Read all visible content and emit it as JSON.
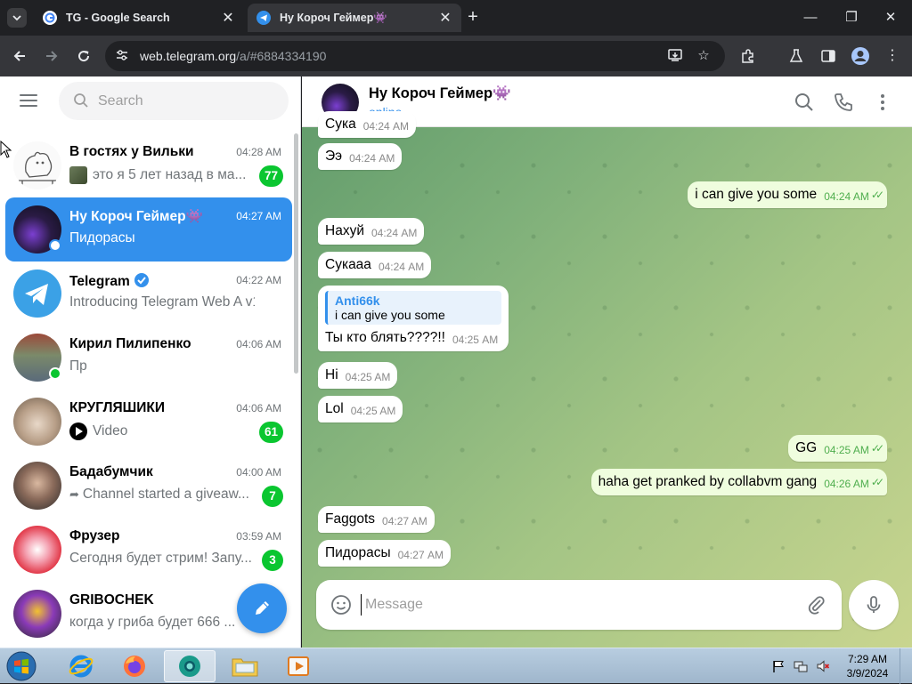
{
  "browser": {
    "tabs": [
      {
        "title": "TG - Google Search",
        "active": false
      },
      {
        "title": "Ну Короч Геймер👾",
        "active": true
      }
    ],
    "url_host": "web.telegram.org",
    "url_path": "/a/#6884334190"
  },
  "sidebar": {
    "search_placeholder": "Search",
    "chats": [
      {
        "name": "В гостях у Вильки",
        "time": "04:28 AM",
        "preview": "это я 5 лет назад в ма...",
        "badge": "77",
        "active": false
      },
      {
        "name": "Ну Короч Геймер👾",
        "time": "04:27 AM",
        "preview": "Пидорасы",
        "badge": "",
        "active": true
      },
      {
        "name": "Telegram",
        "time": "04:22 AM",
        "preview": "Introducing Telegram Web A v1...",
        "badge": "",
        "active": false
      },
      {
        "name": "Кирил Пилипенко",
        "time": "04:06 AM",
        "preview": "Пр",
        "badge": "",
        "active": false
      },
      {
        "name": "КРУГЛЯШИКИ",
        "time": "04:06 AM",
        "preview": "Video",
        "badge": "61",
        "active": false
      },
      {
        "name": "Бадабумчик",
        "time": "04:00 AM",
        "preview": "Channel started a giveaw...",
        "badge": "7",
        "active": false
      },
      {
        "name": "Фрузер",
        "time": "03:59 AM",
        "preview": "Сегодня будет стрим! Запу...",
        "badge": "3",
        "active": false
      },
      {
        "name": "GRIBOCHEK",
        "time": "",
        "preview": "когда у гриба будет 666 ...",
        "badge": "",
        "active": false
      }
    ]
  },
  "chat": {
    "title": "Ну Короч Геймер👾",
    "status": "online",
    "messages": [
      {
        "text": "Сука",
        "time": "04:24 AM",
        "dir": "in"
      },
      {
        "text": "Ээ",
        "time": "04:24 AM",
        "dir": "in"
      },
      {
        "text": "i can give you some",
        "time": "04:24 AM",
        "dir": "out"
      },
      {
        "text": "Нахуй",
        "time": "04:24 AM",
        "dir": "in"
      },
      {
        "text": "Сукааа",
        "time": "04:24 AM",
        "dir": "in"
      },
      {
        "reply_name": "Anti66k",
        "reply_text": "i can give you some",
        "text": "Ты кто блять????!!",
        "time": "04:25 AM",
        "dir": "in"
      },
      {
        "text": "Hi",
        "time": "04:25 AM",
        "dir": "in"
      },
      {
        "text": "Lol",
        "time": "04:25 AM",
        "dir": "in"
      },
      {
        "text": "GG",
        "time": "04:25 AM",
        "dir": "out"
      },
      {
        "text": "haha get pranked by collabvm gang",
        "time": "04:26 AM",
        "dir": "out"
      },
      {
        "text": "Faggots",
        "time": "04:27 AM",
        "dir": "in"
      },
      {
        "text": "Пидорасы",
        "time": "04:27 AM",
        "dir": "in"
      }
    ],
    "composer_placeholder": "Message"
  },
  "taskbar": {
    "time": "7:29 AM",
    "date": "3/9/2024"
  },
  "colors": {
    "accent": "#3390ec",
    "unread_badge": "#0ac630",
    "outgoing_bubble": "#effdde"
  }
}
